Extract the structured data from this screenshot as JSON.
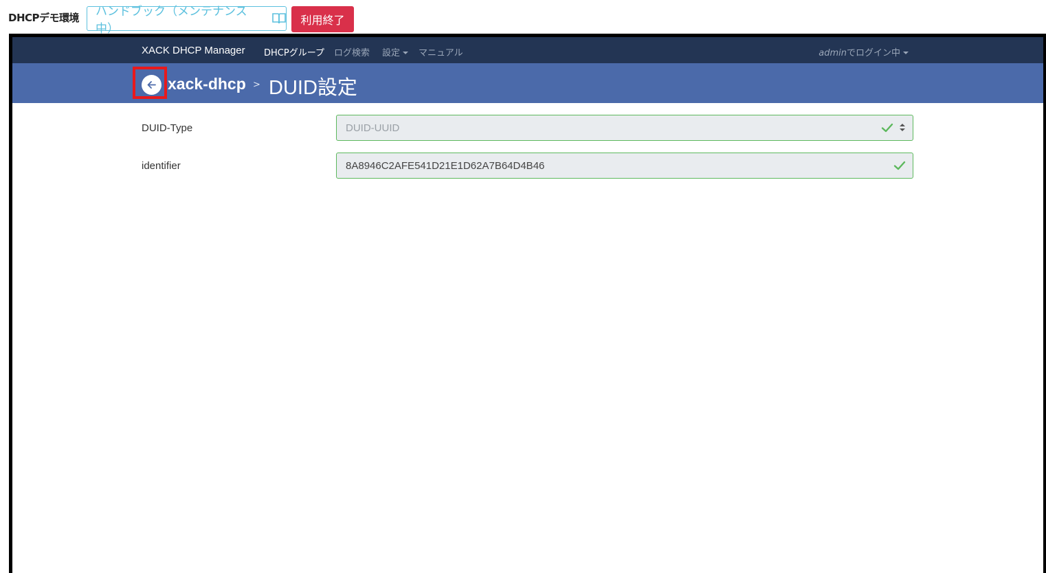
{
  "topbar": {
    "env_label": "DHCPデモ環境",
    "handbook_label": "ハンドブック（メンテナンス中）",
    "exit_label": "利用終了"
  },
  "nav": {
    "brand": "XACK DHCP Manager",
    "items": [
      {
        "label": "DHCPグループ",
        "active": true
      },
      {
        "label": "ログ検索"
      },
      {
        "label": "設定",
        "dropdown": true
      },
      {
        "label": "マニュアル"
      }
    ],
    "user_name": "admin",
    "user_suffix": "でログイン中"
  },
  "breadcrumb": {
    "parent": "xack-dhcp",
    "separator": ">",
    "current": "DUID設定"
  },
  "form": {
    "duid_type": {
      "label": "DUID-Type",
      "value": "DUID-UUID"
    },
    "identifier": {
      "label": "identifier",
      "value": "8A8946C2AFE541D21E1D62A7B64D4B46"
    }
  },
  "colors": {
    "navbar_bg": "#233554",
    "header_bg": "#4b6aaa",
    "success": "#5cb85c",
    "danger": "#d9304a",
    "info": "#5bc0de",
    "highlight": "#e8191c"
  },
  "icons": [
    "book-icon",
    "arrow-left-circle-icon",
    "check-icon",
    "sort-icon",
    "caret-down-icon"
  ]
}
